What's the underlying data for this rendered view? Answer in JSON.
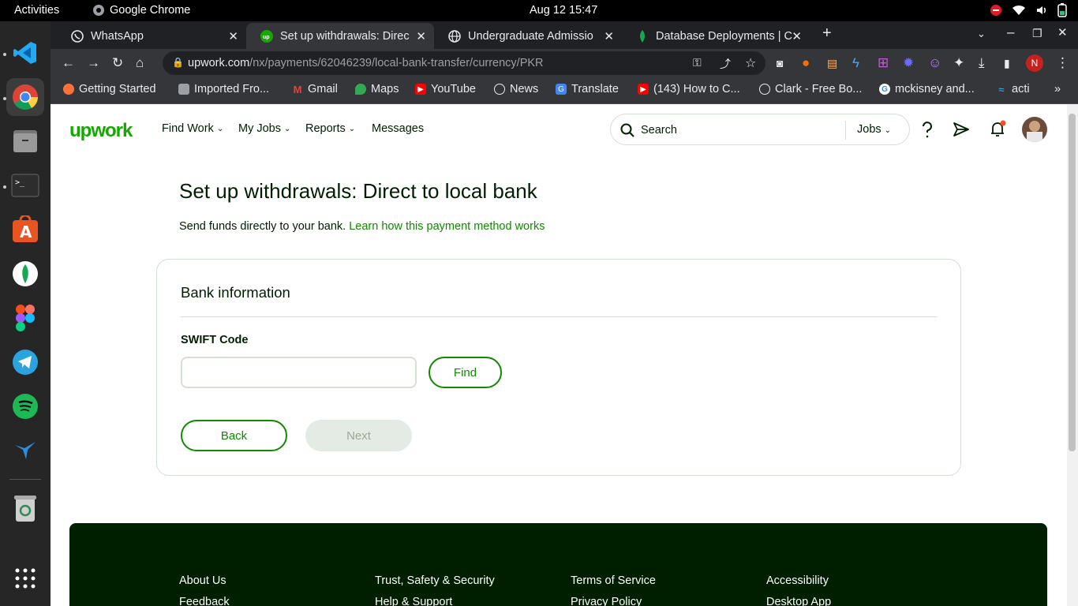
{
  "system": {
    "activities": "Activities",
    "app_name": "Google Chrome",
    "clock": "Aug 12  15:47"
  },
  "tabs": [
    {
      "title": "WhatsApp",
      "icon": "whatsapp-icon"
    },
    {
      "title": "Set up withdrawals: Direc",
      "icon": "upwork-icon",
      "active": true
    },
    {
      "title": "Undergraduate Admissio",
      "icon": "globe-icon"
    },
    {
      "title": "Database Deployments | C",
      "icon": "mongodb-leaf-icon"
    }
  ],
  "omnibox": {
    "host": "upwork.com",
    "path": "/nx/payments/62046239/local-bank-transfer/currency/PKR"
  },
  "profile_initial": "N",
  "bookmarks": [
    {
      "label": "Getting Started"
    },
    {
      "label": "Imported Fro..."
    },
    {
      "label": "Gmail"
    },
    {
      "label": "Maps"
    },
    {
      "label": "YouTube"
    },
    {
      "label": "News"
    },
    {
      "label": "Translate"
    },
    {
      "label": "(143) How to C..."
    },
    {
      "label": "Clark - Free Bo..."
    },
    {
      "label": "mckisney and..."
    },
    {
      "label": "acti"
    }
  ],
  "header": {
    "logo": "upwork",
    "nav": [
      {
        "label": "Find Work"
      },
      {
        "label": "My Jobs"
      },
      {
        "label": "Reports"
      },
      {
        "label": "Messages"
      }
    ],
    "search_placeholder": "Search",
    "search_scope": "Jobs"
  },
  "main": {
    "title": "Set up withdrawals: Direct to local bank",
    "subtitle": "Send funds directly to your bank.",
    "learn_link": "Learn how this payment method works",
    "card": {
      "heading": "Bank information",
      "swift_label": "SWIFT Code",
      "swift_value": "",
      "find_label": "Find",
      "back_label": "Back",
      "next_label": "Next"
    }
  },
  "footer": {
    "links": [
      [
        "About Us",
        "Feedback"
      ],
      [
        "Trust, Safety & Security",
        "Help & Support"
      ],
      [
        "Terms of Service",
        "Privacy Policy"
      ],
      [
        "Accessibility",
        "Desktop App"
      ]
    ]
  },
  "colors": {
    "brand_green": "#14a800",
    "link_green": "#108a00",
    "footer_bg": "#001e00"
  }
}
